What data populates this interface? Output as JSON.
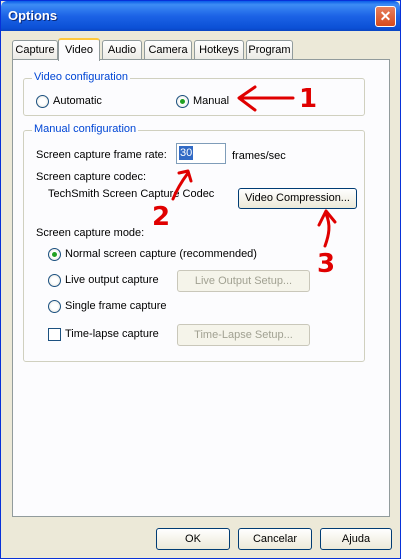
{
  "window": {
    "title": "Options",
    "close_glyph": "✕"
  },
  "tabs": [
    {
      "label": "Capture"
    },
    {
      "label": "Video",
      "active": true
    },
    {
      "label": "Audio"
    },
    {
      "label": "Camera"
    },
    {
      "label": "Hotkeys"
    },
    {
      "label": "Program"
    }
  ],
  "video_config": {
    "group_label": "Video configuration",
    "automatic_label": "Automatic",
    "manual_label": "Manual",
    "selected": "Manual"
  },
  "manual_config": {
    "group_label": "Manual configuration",
    "frame_rate_label": "Screen capture frame rate:",
    "frame_rate_value": "30",
    "frame_rate_unit": "frames/sec",
    "codec_label": "Screen capture codec:",
    "codec_value": "TechSmith Screen Capture Codec",
    "compression_button": "Video Compression...",
    "mode_label": "Screen capture mode:",
    "modes": [
      {
        "label": "Normal screen capture (recommended)",
        "selected": true
      },
      {
        "label": "Live output capture",
        "selected": false
      },
      {
        "label": "Single frame capture",
        "selected": false
      }
    ],
    "timelapse_label": "Time-lapse capture",
    "timelapse_checked": false,
    "live_output_setup_button": "Live Output Setup...",
    "timelapse_setup_button": "Time-Lapse Setup..."
  },
  "footer": {
    "ok": "OK",
    "cancel": "Cancelar",
    "help": "Ajuda"
  },
  "annotations": {
    "one": "1",
    "two": "2",
    "three": "3",
    "color": "#e00000"
  }
}
